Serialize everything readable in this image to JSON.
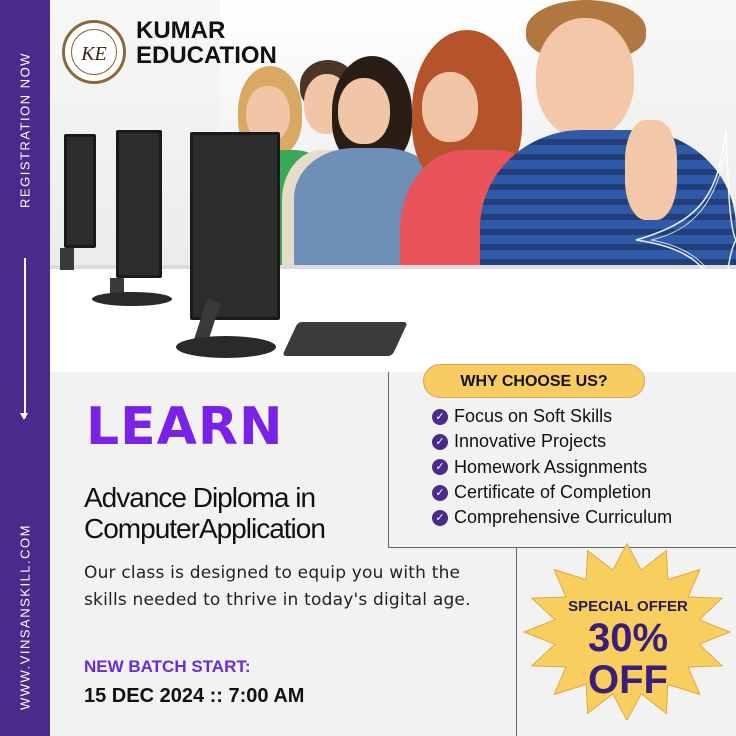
{
  "sidebar": {
    "top_text": "REGISTRATION NOW",
    "bottom_text": "WWW.VINSANSKILL.COM"
  },
  "brand": {
    "logo_initials": "KE",
    "line1": "KUMAR",
    "line2": "EDUCATION"
  },
  "main": {
    "headline": "LEARN",
    "course_line1": "Advance Diploma in",
    "course_line2": "ComputerApplication",
    "description": "Our class is designed to equip you with the skills needed to thrive in today's digital age."
  },
  "why": {
    "title": "WHY CHOOSE US?",
    "items": [
      "Focus on Soft Skills",
      "Innovative Projects",
      "Homework Assignments",
      "Certificate of Completion",
      "Comprehensive Curriculum"
    ]
  },
  "batch": {
    "label": "NEW BATCH START:",
    "date": "15 DEC 2024 :: 7:00 AM"
  },
  "offer": {
    "line1": "SPECIAL OFFER",
    "line2": "30%",
    "line3": "OFF"
  },
  "colors": {
    "sidebar": "#4a2a8a",
    "accent_purple": "#7b22e8",
    "pill_yellow": "#f8cc63",
    "burst_yellow": "#f8ce5e"
  },
  "icons": {
    "check": "check-circle-icon",
    "arrow": "arrow-down-icon"
  }
}
